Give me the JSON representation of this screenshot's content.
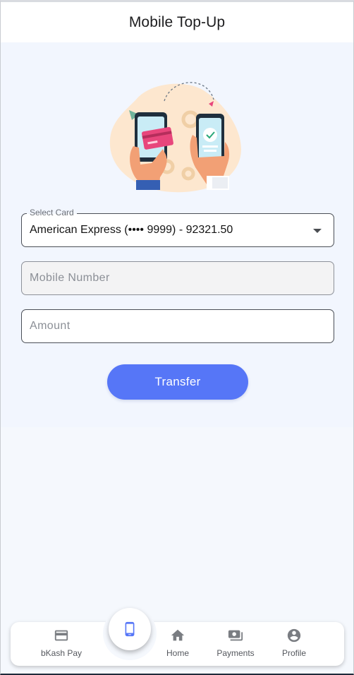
{
  "header": {
    "title": "Mobile Top-Up"
  },
  "form": {
    "card_label": "Select Card",
    "card_value": "American Express (•••• 9999) - 92321.50",
    "mobile_placeholder": "Mobile Number",
    "amount_placeholder": "Amount",
    "submit_label": "Transfer"
  },
  "nav": {
    "items": [
      {
        "label": "bKash Pay",
        "icon": "credit-card-icon"
      },
      {
        "label": "Home",
        "icon": "home-icon"
      },
      {
        "label": "Payments",
        "icon": "payments-icon"
      },
      {
        "label": "Profile",
        "icon": "account-circle-icon"
      }
    ],
    "fab_icon": "smartphone-icon"
  },
  "colors": {
    "accent": "#5676f7",
    "panel": "#f2f6fe",
    "background": "#f5f8fd"
  }
}
